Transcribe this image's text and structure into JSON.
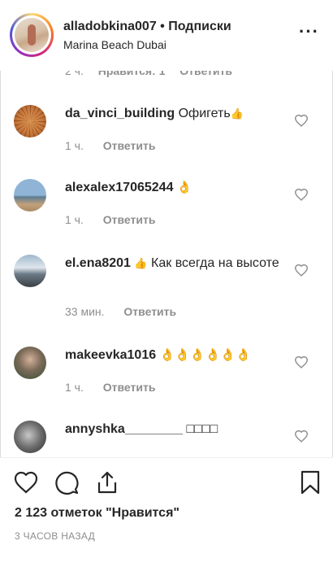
{
  "header": {
    "username": "alladobkina007",
    "separator": "•",
    "follow_status": "Подписки",
    "location": "Marina Beach Dubai"
  },
  "partial_comment": {
    "time": "2 ч.",
    "likes": "Нравится: 1",
    "reply": "Ответить"
  },
  "comments": [
    {
      "username": "da_vinci_building",
      "text": "Офигеть",
      "emoji": "👍",
      "time": "1 ч.",
      "reply": "Ответить"
    },
    {
      "username": "alexalex17065244",
      "text": "",
      "emoji": "👌",
      "time": "1 ч.",
      "reply": "Ответить"
    },
    {
      "username": "el.ena8201",
      "text": "Как всегда на высоте",
      "emoji": "👍",
      "time": "33 мин.",
      "reply": "Ответить"
    },
    {
      "username": "makeevka1016",
      "text": "",
      "emoji": "👌👌👌👌👌👌",
      "time": "1 ч.",
      "reply": "Ответить"
    },
    {
      "username": "annyshka________",
      "text": "",
      "emoji": "□□□□",
      "time": "",
      "reply": ""
    }
  ],
  "footer": {
    "likes": "2 123 отметок \"Нравится\"",
    "time_ago": "3 ЧАСОВ НАЗАД"
  }
}
